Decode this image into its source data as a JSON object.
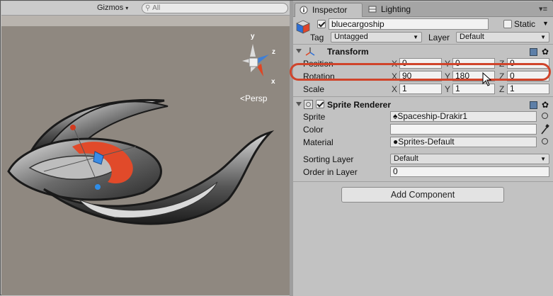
{
  "scene": {
    "gizmos_label": "Gizmos",
    "search_placeholder": "All",
    "persp_label": "Persp",
    "axes": {
      "x": "x",
      "y": "y",
      "z": "z"
    }
  },
  "tabs": [
    {
      "label": "Inspector",
      "active": true
    },
    {
      "label": "Lighting",
      "active": false
    }
  ],
  "object": {
    "active": true,
    "name": "bluecargoship",
    "static_label": "Static",
    "static": false,
    "tag_label": "Tag",
    "tag_value": "Untagged",
    "layer_label": "Layer",
    "layer_value": "Default"
  },
  "transform": {
    "title": "Transform",
    "rows": [
      {
        "label": "Position",
        "x": "0",
        "y": "0",
        "z": "0"
      },
      {
        "label": "Rotation",
        "x": "90",
        "y": "180",
        "z": "0"
      },
      {
        "label": "Scale",
        "x": "1",
        "y": "1",
        "z": "1"
      }
    ]
  },
  "sprite_renderer": {
    "title": "Sprite Renderer",
    "enabled": true,
    "sprite_label": "Sprite",
    "sprite_value": "Spaceship-Drakir1",
    "color_label": "Color",
    "material_label": "Material",
    "material_value": "Sprites-Default",
    "sorting_layer_label": "Sorting Layer",
    "sorting_layer_value": "Default",
    "order_label": "Order in Layer",
    "order_value": "0"
  },
  "add_component_label": "Add Component",
  "colors": {
    "highlight": "#d0442b",
    "scene_bg": "#8f8880",
    "panel_bg": "#c2c2c2"
  }
}
